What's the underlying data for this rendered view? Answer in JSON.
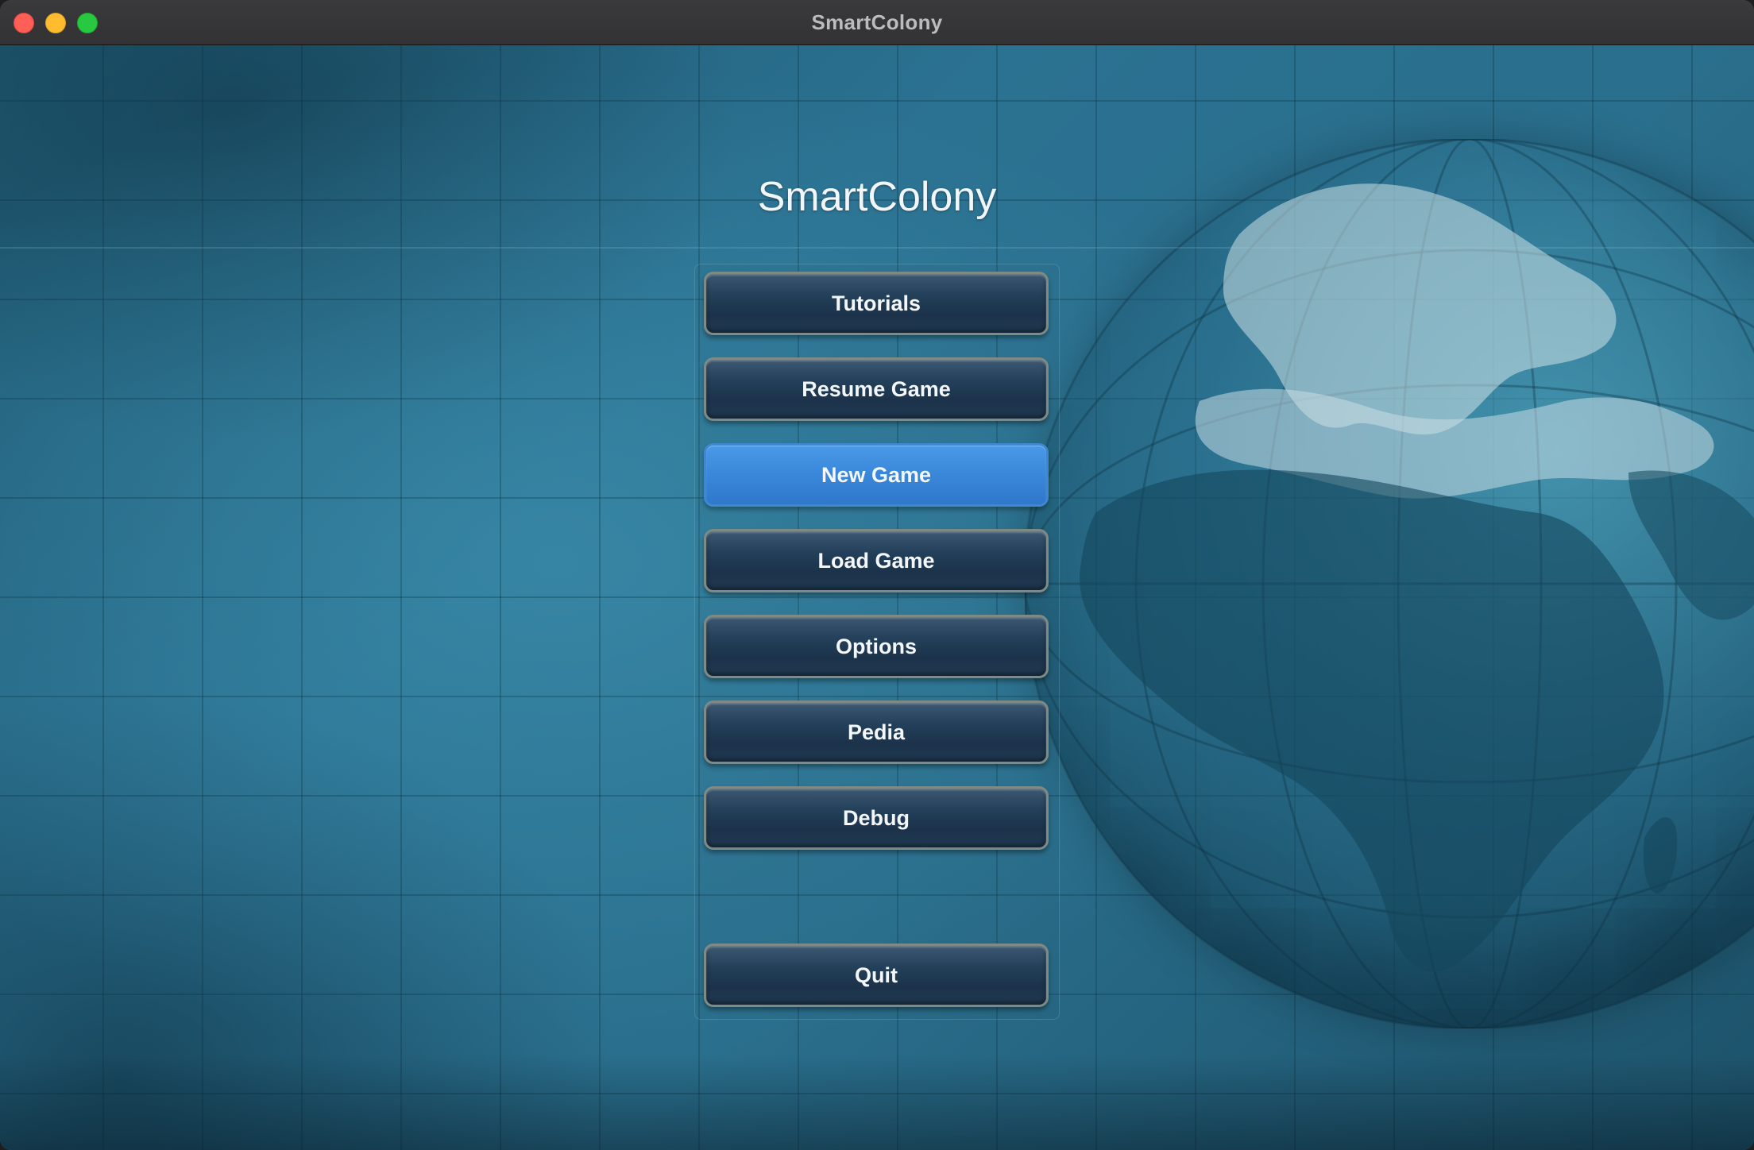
{
  "window": {
    "title": "SmartColony"
  },
  "menu": {
    "title": "SmartColony",
    "buttons": [
      {
        "label": "Tutorials",
        "selected": false
      },
      {
        "label": "Resume Game",
        "selected": false
      },
      {
        "label": "New Game",
        "selected": true
      },
      {
        "label": "Load Game",
        "selected": false
      },
      {
        "label": "Options",
        "selected": false
      },
      {
        "label": "Pedia",
        "selected": false
      },
      {
        "label": "Debug",
        "selected": false
      }
    ],
    "quit": {
      "label": "Quit"
    }
  },
  "colors": {
    "background": "#2a6f8d",
    "button": "#24405a",
    "button_selected": "#3a87d9",
    "button_border": "#7d8a86"
  },
  "icons": {
    "close": "close-icon",
    "minimize": "minimize-icon",
    "zoom": "zoom-icon",
    "globe": "globe-map-icon"
  }
}
